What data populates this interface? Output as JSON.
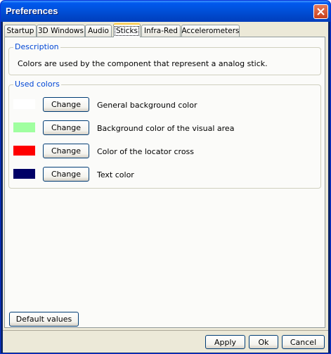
{
  "window": {
    "title": "Preferences"
  },
  "tabs": [
    {
      "label": "Startup"
    },
    {
      "label": "3D Windows"
    },
    {
      "label": "Audio"
    },
    {
      "label": "Sticks"
    },
    {
      "label": "Infra-Red"
    },
    {
      "label": "Accelerometers"
    }
  ],
  "active_tab": "Sticks",
  "description": {
    "title": "Description",
    "text": "Colors are used by the component that represent a analog stick."
  },
  "used_colors": {
    "title": "Used colors",
    "change_label": "Change",
    "rows": [
      {
        "color": "#ffffff",
        "label": "General background color"
      },
      {
        "color": "#a0ffa0",
        "label": "Background color of the visual area"
      },
      {
        "color": "#ff0000",
        "label": "Color of the locator cross"
      },
      {
        "color": "#000066",
        "label": "Text color"
      }
    ]
  },
  "buttons": {
    "default_values": "Default values",
    "apply": "Apply",
    "ok": "Ok",
    "cancel": "Cancel"
  }
}
